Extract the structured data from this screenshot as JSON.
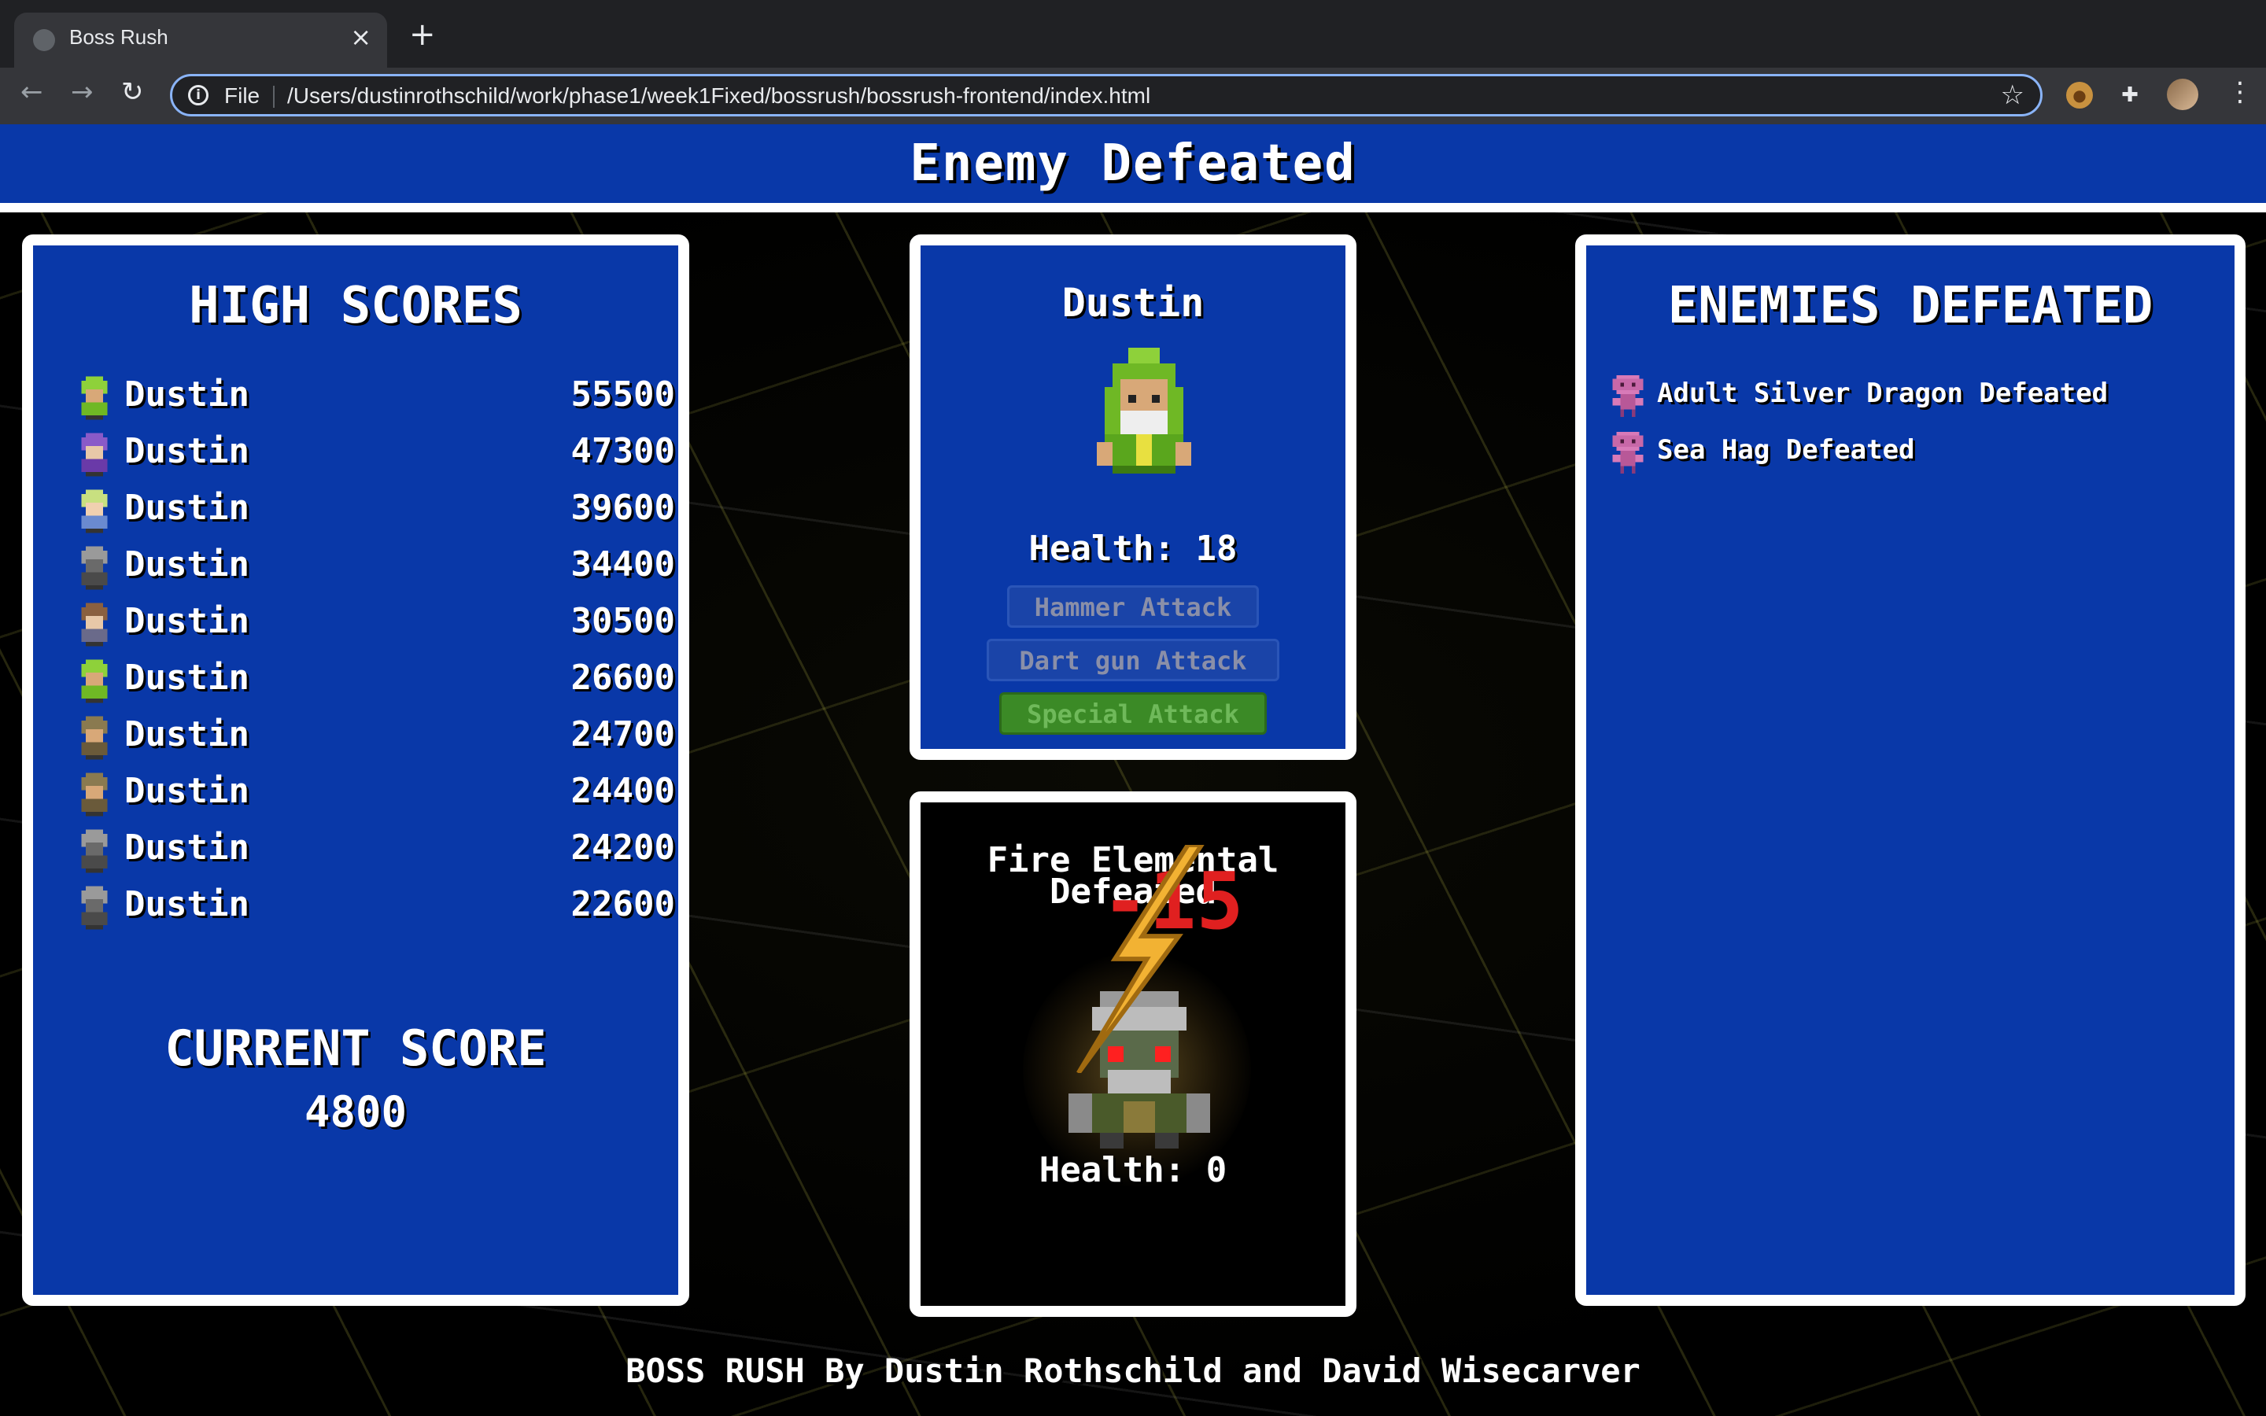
{
  "browser": {
    "tab_title": "Boss Rush",
    "tab_close": "×",
    "new_tab": "+",
    "file_label": "File",
    "url": "/Users/dustinrothschild/work/phase1/week1Fixed/bossrush/bossrush-frontend/index.html",
    "icons": [
      "back-arrow-icon",
      "forward-arrow-icon",
      "reload-icon",
      "info-icon",
      "bookmark-star-icon",
      "cookie-extension-icon",
      "puzzle-extensions-icon",
      "profile-avatar-icon",
      "more-menu-icon"
    ]
  },
  "banner": {
    "title": "Enemy Defeated"
  },
  "high_scores": {
    "title": "HIGH SCORES",
    "entries": [
      {
        "name": "Dustin",
        "score": "55500",
        "avatar": "green-wizard"
      },
      {
        "name": "Dustin",
        "score": "47300",
        "avatar": "purple-hair"
      },
      {
        "name": "Dustin",
        "score": "39600",
        "avatar": "blonde-elf"
      },
      {
        "name": "Dustin",
        "score": "34400",
        "avatar": "grey-knight"
      },
      {
        "name": "Dustin",
        "score": "30500",
        "avatar": "brown-hair"
      },
      {
        "name": "Dustin",
        "score": "26600",
        "avatar": "green-wizard"
      },
      {
        "name": "Dustin",
        "score": "24700",
        "avatar": "brown-hood"
      },
      {
        "name": "Dustin",
        "score": "24400",
        "avatar": "brown-hood"
      },
      {
        "name": "Dustin",
        "score": "24200",
        "avatar": "grey-knight"
      },
      {
        "name": "Dustin",
        "score": "22600",
        "avatar": "grey-knight"
      }
    ],
    "current_score_label": "CURRENT SCORE",
    "current_score": "4800"
  },
  "player": {
    "name": "Dustin",
    "health_label": "Health:",
    "health": "18",
    "attacks": {
      "hammer": "Hammer Attack",
      "dart": "Dart gun Attack",
      "special": "Special Attack"
    }
  },
  "enemy": {
    "name": "Fire Elemental Defeated",
    "damage": "-15",
    "health_label": "Health:",
    "health": "0"
  },
  "enemies_defeated": {
    "title": "ENEMIES DEFEATED",
    "items": [
      {
        "text": "Adult Silver Dragon Defeated"
      },
      {
        "text": "Sea Hag Defeated"
      }
    ]
  },
  "footer": {
    "credits": "BOSS RUSH By Dustin Rothschild and David Wisecarver"
  },
  "colors": {
    "panel_blue": "#0938a8",
    "special_green": "#3b8a26",
    "damage_red": "#e02020",
    "lightning_yellow": "#f2b233"
  }
}
